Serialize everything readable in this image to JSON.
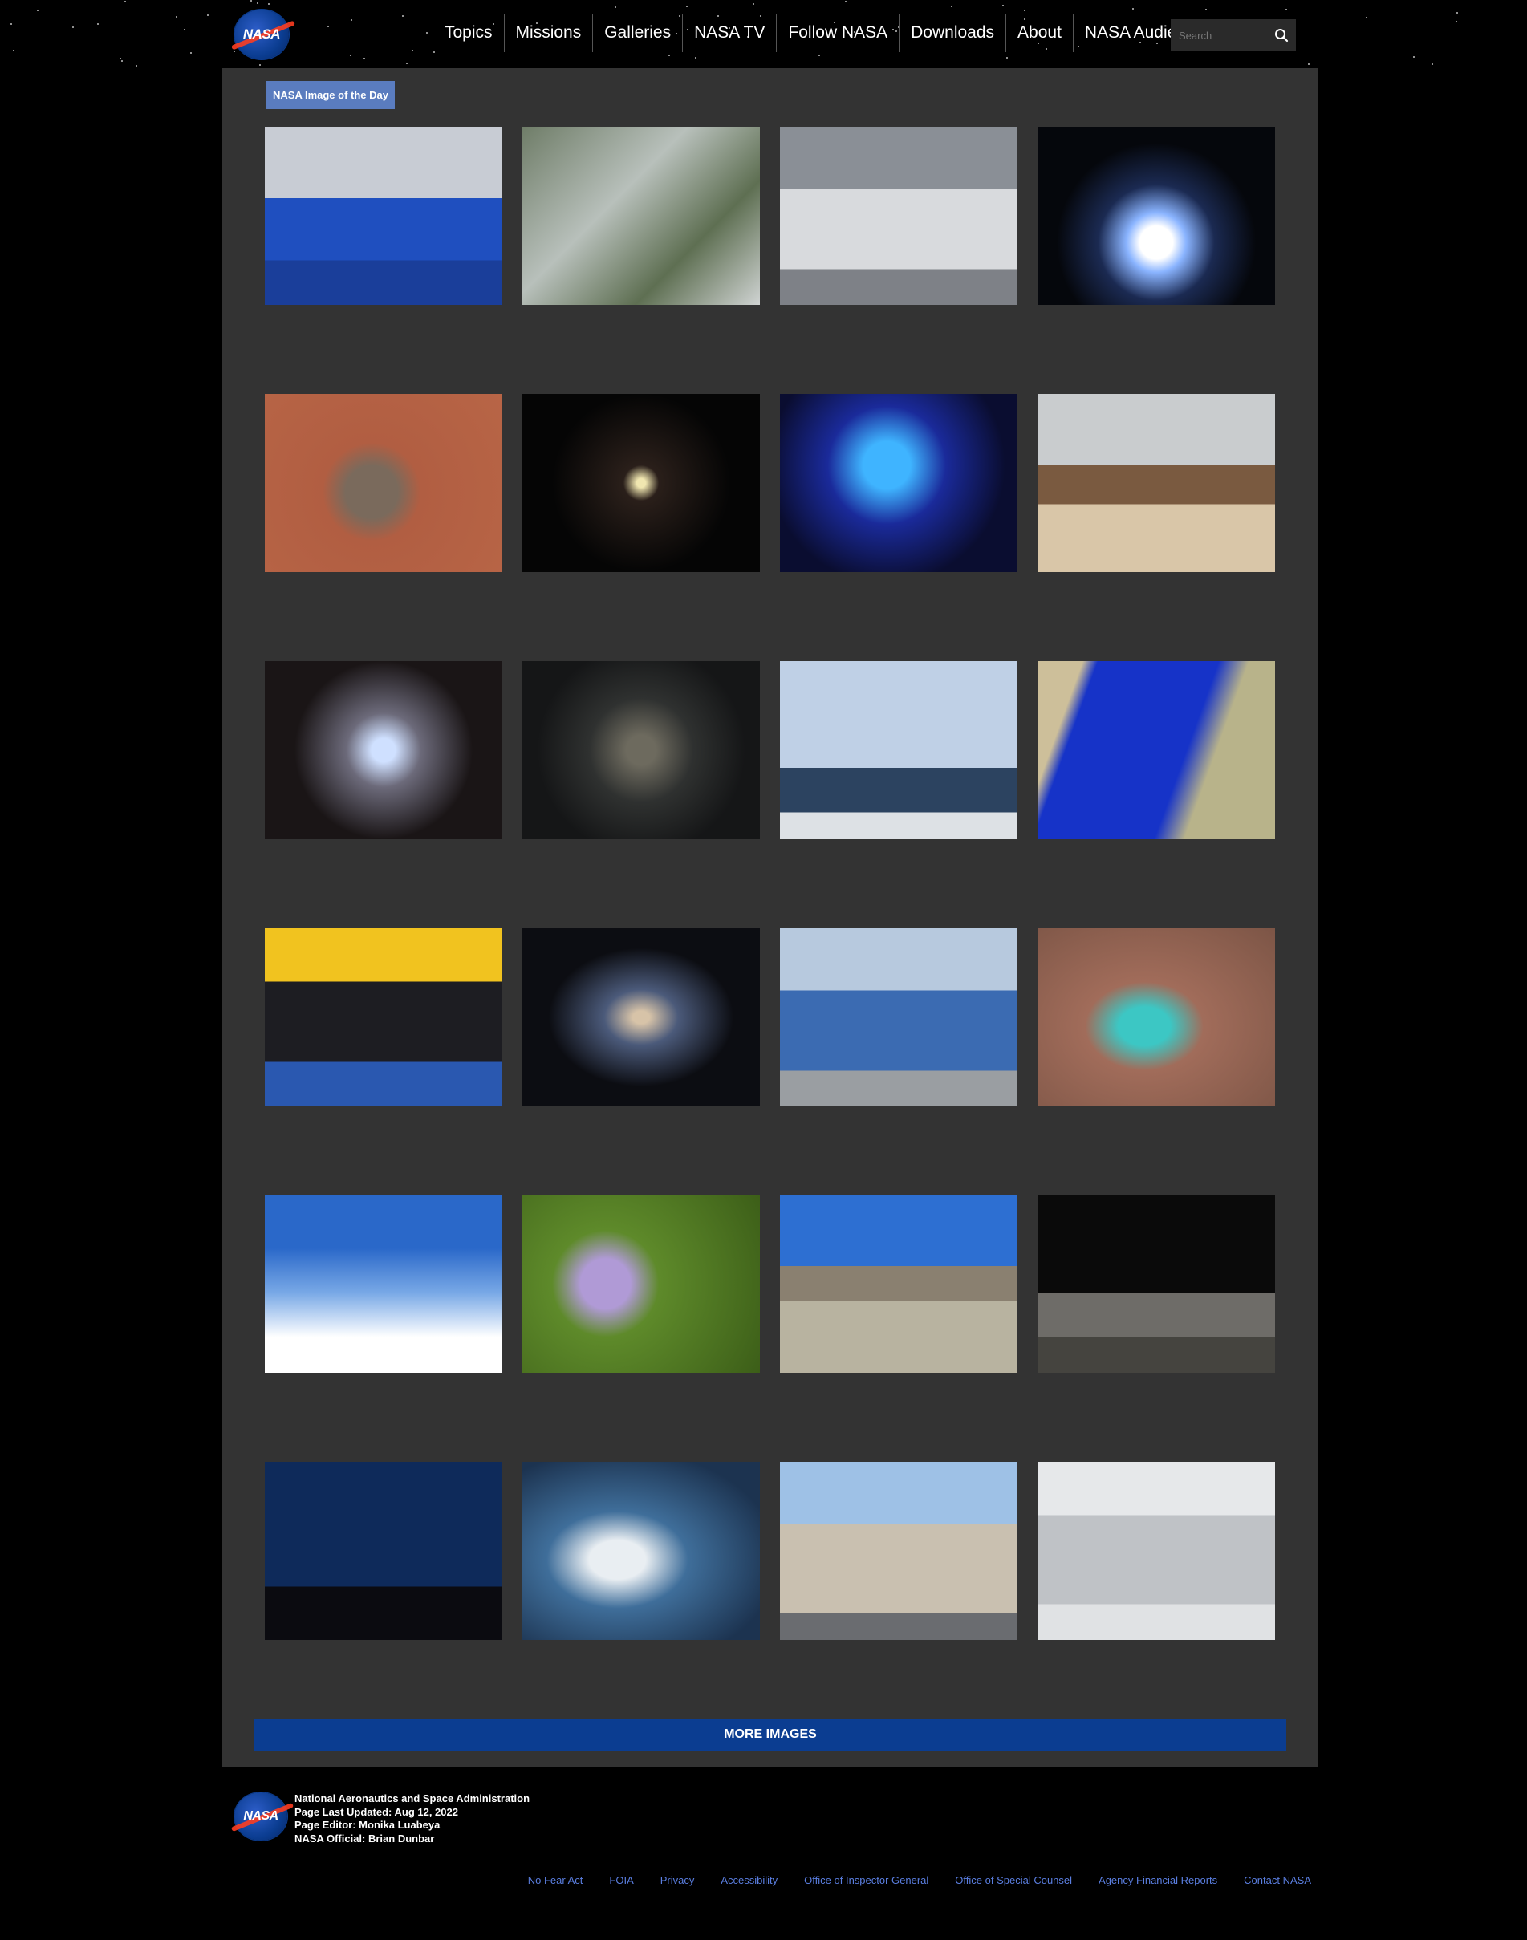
{
  "header": {
    "logo_text": "NASA",
    "nav": [
      "Topics",
      "Missions",
      "Galleries",
      "NASA TV",
      "Follow NASA",
      "Downloads",
      "About",
      "NASA Audiences"
    ],
    "search_placeholder": "Search"
  },
  "gallery": {
    "label": "NASA Image of the Day",
    "more_button": "MORE IMAGES",
    "tiles": [
      {
        "subject": "osprey-nest-on-nasa-sign",
        "bg": "linear-gradient(#c8ccd4 0 40%, #1f4fbf 40% 75%, #1a3e9a 75%)"
      },
      {
        "subject": "earth-clouds-satellite",
        "bg": "linear-gradient(135deg,#6f7d68,#b8c0bb 40%,#5e6f52 70%,#cfd3d2)"
      },
      {
        "subject": "engineers-in-cleanroom",
        "bg": "linear-gradient(#8a8f96 0 35%, #d8dadd 35% 80%, #7e8187 80%)"
      },
      {
        "subject": "lunar-lander-illustration",
        "bg": "radial-gradient(circle at 50% 65%, #ffffff 0 10%, #8ab4ff 18%, #1b2a52 35%, #05070c 60%)"
      },
      {
        "subject": "mars-lander-overhead",
        "bg": "radial-gradient(circle at 45% 55%, #7a6a5c 0 16%, #b15e42 30%, #b86546 100%)"
      },
      {
        "subject": "galaxy-cluster-deep-field",
        "bg": "radial-gradient(circle at 50% 50%, #f0e6b0 0 3%, #2a1f1a 12%, #050505 60%)"
      },
      {
        "subject": "astronaut-helmet-blue-light",
        "bg": "radial-gradient(circle at 45% 40%, #3fb4ff 0 14%, #1a2a9a 35%, #0a0d30 70%)"
      },
      {
        "subject": "lunar-rover-prototype",
        "bg": "linear-gradient(#c9ccce 0 40%, #7a5a40 40% 62%, #d9c6a8 62%)"
      },
      {
        "subject": "globular-star-cluster",
        "bg": "radial-gradient(circle at 50% 50%, #cfe0ff 0 8%, #6c6a7a 25%, #1a1516 60%)"
      },
      {
        "subject": "city-lights-from-orbit",
        "bg": "radial-gradient(circle at 50% 50%, #6d6a5e 0 10%, #2f3130 35%, #151617 70%)"
      },
      {
        "subject": "astronaut-crew-portrait",
        "bg": "linear-gradient(#bfd0e6 0 60%, #2c4360 60% 85%, #dde1e5 85%)"
      },
      {
        "subject": "salt-lake-satellite-view",
        "bg": "linear-gradient(110deg,#cdbf9a 0 15%,#1633c8 20% 60%,#b8b38a 70%)"
      },
      {
        "subject": "orion-capsule-recovery",
        "bg": "linear-gradient(#f1c31f 0 30%, #1d1d22 30% 75%, #2a58b0 75%)"
      },
      {
        "subject": "spiral-galaxy",
        "bg": "radial-gradient(ellipse at 50% 50%, #d7c3a8 0 5%, #4b5a7a 22%, #0c0d12 55%)"
      },
      {
        "subject": "interns-with-aircraft",
        "bg": "linear-gradient(#b7c9de 0 35%, #3b6bb2 35% 80%, #9a9ea2 80%)"
      },
      {
        "subject": "turquoise-lake-aerial",
        "bg": "radial-gradient(ellipse at 45% 55%, #3cc7c4 0 14%, #a16c5a 32%, #7c5546 100%)"
      },
      {
        "subject": "hybrid-electric-aircraft",
        "bg": "linear-gradient(#2a68c9 0 30%, #78a8e6 55%, #ffffff 80%)"
      },
      {
        "subject": "passion-flowers",
        "bg": "radial-gradient(circle at 35% 50%, #b09ad6 0 14%, #5e8a2a 30%, #3c5e18 100%)"
      },
      {
        "subject": "desert-field-team",
        "bg": "linear-gradient(#2d6fd2 0 40%, #8a8070 40% 60%, #b8b3a0 60%)"
      },
      {
        "subject": "apollo-astronaut-with-flag",
        "bg": "linear-gradient(#0a0a0a 0 55%, #6e6c68 55% 80%, #45443f 80%)"
      },
      {
        "subject": "rocket-launch-at-night",
        "bg": "linear-gradient(#0e2a5a 0 70%, #0b0b10 70%)"
      },
      {
        "subject": "clouds-from-space-station",
        "bg": "radial-gradient(ellipse at 40% 55%, #e9eef2 0 14%, #3f6e9a 35%, #1c3350 80%)"
      },
      {
        "subject": "test-stand-facility",
        "bg": "linear-gradient(#9ec1e6 0 35%, #c9c0b0 35% 85%, #6a6c70 85%)"
      },
      {
        "subject": "spacecraft-assembly-hangar",
        "bg": "linear-gradient(#e6e8ea 0 30%, #bfc2c6 30% 80%, #e0e2e4 80%)"
      }
    ]
  },
  "footer": {
    "logo_text": "NASA",
    "agency": "National Aeronautics and Space Administration",
    "updated": "Page Last Updated: Aug 12, 2022",
    "editor": "Page Editor: Monika Luabeya",
    "official": "NASA Official: Brian Dunbar",
    "links": [
      "No Fear Act",
      "FOIA",
      "Privacy",
      "Accessibility",
      "Office of Inspector General",
      "Office of Special Counsel",
      "Agency Financial Reports",
      "Contact NASA"
    ]
  }
}
